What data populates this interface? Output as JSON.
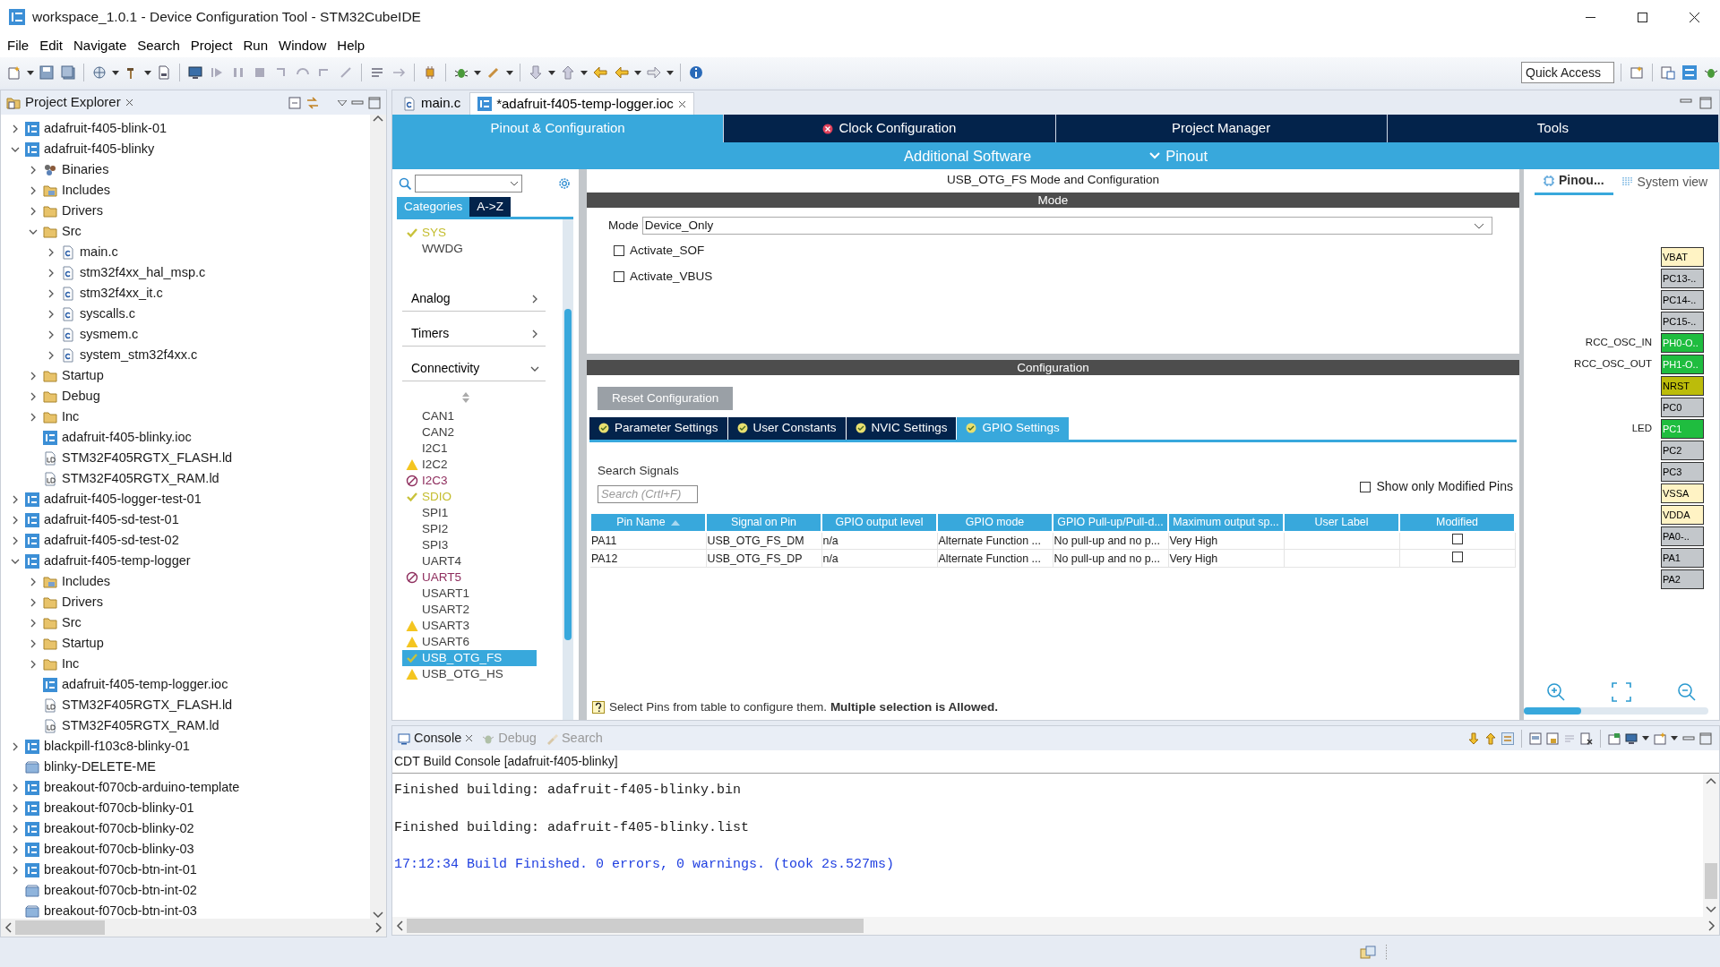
{
  "window": {
    "title": "workspace_1.0.1 - Device Configuration Tool - STM32CubeIDE"
  },
  "menu": [
    "File",
    "Edit",
    "Navigate",
    "Search",
    "Project",
    "Run",
    "Window",
    "Help"
  ],
  "quick_access": {
    "placeholder": "Quick Access"
  },
  "project_explorer": {
    "title": "Project Explorer",
    "tree": [
      {
        "label": "adafruit-f405-blink-01",
        "kind": "project",
        "expanded": false
      },
      {
        "label": "adafruit-f405-blinky",
        "kind": "project",
        "expanded": true,
        "children": [
          {
            "label": "Binaries",
            "kind": "binaries",
            "expanded": false
          },
          {
            "label": "Includes",
            "kind": "includes",
            "expanded": false
          },
          {
            "label": "Drivers",
            "kind": "folder",
            "expanded": false
          },
          {
            "label": "Src",
            "kind": "folder",
            "expanded": true,
            "children": [
              {
                "label": "main.c",
                "kind": "c-file",
                "expanded": false
              },
              {
                "label": "stm32f4xx_hal_msp.c",
                "kind": "c-file",
                "expanded": false
              },
              {
                "label": "stm32f4xx_it.c",
                "kind": "c-file",
                "expanded": false
              },
              {
                "label": "syscalls.c",
                "kind": "c-file",
                "expanded": false
              },
              {
                "label": "sysmem.c",
                "kind": "c-file",
                "expanded": false
              },
              {
                "label": "system_stm32f4xx.c",
                "kind": "c-file",
                "expanded": false
              }
            ]
          },
          {
            "label": "Startup",
            "kind": "folder",
            "expanded": false
          },
          {
            "label": "Debug",
            "kind": "folder",
            "expanded": false
          },
          {
            "label": "Inc",
            "kind": "folder",
            "expanded": false
          },
          {
            "label": "adafruit-f405-blinky.ioc",
            "kind": "ioc-file"
          },
          {
            "label": "STM32F405RGTX_FLASH.ld",
            "kind": "ld-file"
          },
          {
            "label": "STM32F405RGTX_RAM.ld",
            "kind": "ld-file"
          }
        ]
      },
      {
        "label": "adafruit-f405-logger-test-01",
        "kind": "project",
        "expanded": false
      },
      {
        "label": "adafruit-f405-sd-test-01",
        "kind": "project",
        "expanded": false
      },
      {
        "label": "adafruit-f405-sd-test-02",
        "kind": "project",
        "expanded": false
      },
      {
        "label": "adafruit-f405-temp-logger",
        "kind": "project",
        "expanded": true,
        "children": [
          {
            "label": "Includes",
            "kind": "includes",
            "expanded": false
          },
          {
            "label": "Drivers",
            "kind": "folder",
            "expanded": false
          },
          {
            "label": "Src",
            "kind": "folder",
            "expanded": false
          },
          {
            "label": "Startup",
            "kind": "folder",
            "expanded": false
          },
          {
            "label": "Inc",
            "kind": "folder",
            "expanded": false
          },
          {
            "label": "adafruit-f405-temp-logger.ioc",
            "kind": "ioc-file"
          },
          {
            "label": "STM32F405RGTX_FLASH.ld",
            "kind": "ld-file"
          },
          {
            "label": "STM32F405RGTX_RAM.ld",
            "kind": "ld-file"
          }
        ]
      },
      {
        "label": "blackpill-f103c8-blinky-01",
        "kind": "project",
        "expanded": false
      },
      {
        "label": "blinky-DELETE-ME",
        "kind": "closed-project"
      },
      {
        "label": "breakout-f070cb-arduino-template",
        "kind": "project",
        "expanded": false
      },
      {
        "label": "breakout-f070cb-blinky-01",
        "kind": "project",
        "expanded": false
      },
      {
        "label": "breakout-f070cb-blinky-02",
        "kind": "project",
        "expanded": false
      },
      {
        "label": "breakout-f070cb-blinky-03",
        "kind": "project",
        "expanded": false
      },
      {
        "label": "breakout-f070cb-btn-int-01",
        "kind": "project",
        "expanded": false
      },
      {
        "label": "breakout-f070cb-btn-int-02",
        "kind": "closed-project"
      },
      {
        "label": "breakout-f070cb-btn-int-03",
        "kind": "closed-project"
      }
    ]
  },
  "editor_tabs": [
    {
      "label": "main.c",
      "kind": "c-file",
      "selected": false
    },
    {
      "label": "*adafruit-f405-temp-logger.ioc",
      "kind": "ioc-file",
      "selected": true
    }
  ],
  "main_tabs": [
    {
      "label": "Pinout & Configuration",
      "selected": true,
      "error": false
    },
    {
      "label": "Clock Configuration",
      "selected": false,
      "error": true
    },
    {
      "label": "Project Manager",
      "selected": false,
      "error": false
    },
    {
      "label": "Tools",
      "selected": false,
      "error": false
    }
  ],
  "sub_menu": [
    {
      "label": "Additional Software",
      "dropdown": false
    },
    {
      "label": "Pinout",
      "dropdown": true
    }
  ],
  "categories": {
    "tabs": [
      {
        "label": "Categories",
        "selected": true
      },
      {
        "label": "A->Z",
        "selected": false
      }
    ],
    "items_top": [
      {
        "label": "SYS",
        "kind": "ok",
        "selected": false
      },
      {
        "label": "WWDG",
        "kind": "none",
        "selected": false
      }
    ],
    "groups": [
      {
        "label": "Analog",
        "expanded": false
      },
      {
        "label": "Timers",
        "expanded": false
      },
      {
        "label": "Connectivity",
        "expanded": true
      }
    ],
    "items": [
      {
        "label": "CAN1",
        "kind": "none",
        "selected": false
      },
      {
        "label": "CAN2",
        "kind": "none",
        "selected": false
      },
      {
        "label": "I2C1",
        "kind": "none",
        "selected": false
      },
      {
        "label": "I2C2",
        "kind": "warning",
        "selected": false
      },
      {
        "label": "I2C3",
        "kind": "disabled",
        "selected": false
      },
      {
        "label": "SDIO",
        "kind": "ok",
        "selected": false
      },
      {
        "label": "SPI1",
        "kind": "none",
        "selected": false
      },
      {
        "label": "SPI2",
        "kind": "none",
        "selected": false
      },
      {
        "label": "SPI3",
        "kind": "none",
        "selected": false
      },
      {
        "label": "UART4",
        "kind": "none",
        "selected": false
      },
      {
        "label": "UART5",
        "kind": "disabled",
        "selected": false
      },
      {
        "label": "USART1",
        "kind": "none",
        "selected": false
      },
      {
        "label": "USART2",
        "kind": "none",
        "selected": false
      },
      {
        "label": "USART3",
        "kind": "warning",
        "selected": false
      },
      {
        "label": "USART6",
        "kind": "warning",
        "selected": false
      },
      {
        "label": "USB_OTG_FS",
        "kind": "ok",
        "selected": true
      },
      {
        "label": "USB_OTG_HS",
        "kind": "warning",
        "selected": false
      }
    ]
  },
  "mode_panel": {
    "title": "USB_OTG_FS Mode and Configuration",
    "mode_header": "Mode",
    "mode_label": "Mode",
    "mode_value": "Device_Only",
    "options": [
      {
        "label": "Activate_SOF",
        "checked": false
      },
      {
        "label": "Activate_VBUS",
        "checked": false
      }
    ],
    "config_header": "Configuration",
    "reset_button": "Reset Configuration",
    "tabs": [
      {
        "label": "Parameter Settings",
        "selected": false
      },
      {
        "label": "User Constants",
        "selected": false
      },
      {
        "label": "NVIC Settings",
        "selected": false
      },
      {
        "label": "GPIO Settings",
        "selected": true
      }
    ],
    "search_label": "Search Signals",
    "search_placeholder": "Search (Crtl+F)",
    "show_modified": {
      "label": "Show only Modified Pins",
      "checked": false
    },
    "table": {
      "columns": [
        {
          "label": "Pin Name",
          "sorted": true
        },
        {
          "label": "Signal on Pin",
          "sorted": false
        },
        {
          "label": "GPIO output level",
          "sorted": false
        },
        {
          "label": "GPIO mode",
          "sorted": false
        },
        {
          "label": "GPIO Pull-up/Pull-d...",
          "sorted": false
        },
        {
          "label": "Maximum output sp...",
          "sorted": false
        },
        {
          "label": "User Label",
          "sorted": false
        },
        {
          "label": "Modified",
          "sorted": false
        }
      ],
      "rows": [
        {
          "pin": "PA11",
          "signal": "USB_OTG_FS_DM",
          "output_level": "n/a",
          "mode": "Alternate Function ...",
          "pull": "No pull-up and no p...",
          "speed": "Very High",
          "modified": false
        },
        {
          "pin": "PA12",
          "signal": "USB_OTG_FS_DP",
          "output_level": "n/a",
          "mode": "Alternate Function ...",
          "pull": "No pull-up and no p...",
          "speed": "Very High",
          "modified": false
        }
      ]
    },
    "hint": "Select Pins from table to configure them. **Multiple selection is Allowed.**"
  },
  "pinout": {
    "tabs": [
      {
        "label": "Pinou...",
        "selected": true
      },
      {
        "label": "System view",
        "selected": false
      }
    ],
    "pins": [
      {
        "name": "VBAT",
        "color": "#fff3c4"
      },
      {
        "name": "PC13-..",
        "color": "#c3c7cb"
      },
      {
        "name": "PC14-..",
        "color": "#c3c7cb"
      },
      {
        "name": "PC15-..",
        "color": "#c3c7cb"
      },
      {
        "name": "PH0-O..",
        "color": "#1fbd3f",
        "signal": "RCC_OSC_IN"
      },
      {
        "name": "PH1-O..",
        "color": "#1fbd3f",
        "signal": "RCC_OSC_OUT"
      },
      {
        "name": "NRST",
        "color": "#bcbc0a"
      },
      {
        "name": "PC0",
        "color": "#c3c7cb"
      },
      {
        "name": "PC1",
        "color": "#1fbd3f",
        "signal": "LED"
      },
      {
        "name": "PC2",
        "color": "#c3c7cb"
      },
      {
        "name": "PC3",
        "color": "#c3c7cb"
      },
      {
        "name": "VSSA",
        "color": "#fff3c4"
      },
      {
        "name": "VDDA",
        "color": "#fff3c4"
      },
      {
        "name": "PA0-..",
        "color": "#c3c7cb"
      },
      {
        "name": "PA1",
        "color": "#c3c7cb"
      },
      {
        "name": "PA2",
        "color": "#c3c7cb"
      }
    ]
  },
  "console": {
    "tabs": [
      {
        "label": "Console",
        "selected": true
      },
      {
        "label": "Debug",
        "selected": false
      },
      {
        "label": "Search",
        "selected": false
      }
    ],
    "title": "CDT Build Console [adafruit-f405-blinky]",
    "lines": [
      {
        "text": "Finished building: adafruit-f405-blinky.bin",
        "kind": "plain"
      },
      {
        "text": "Finished building: adafruit-f405-blinky.list",
        "kind": "plain"
      },
      {
        "text": "17:12:34 Build Finished. 0 errors, 0 warnings. (took 2s.527ms)",
        "kind": "info"
      }
    ]
  }
}
